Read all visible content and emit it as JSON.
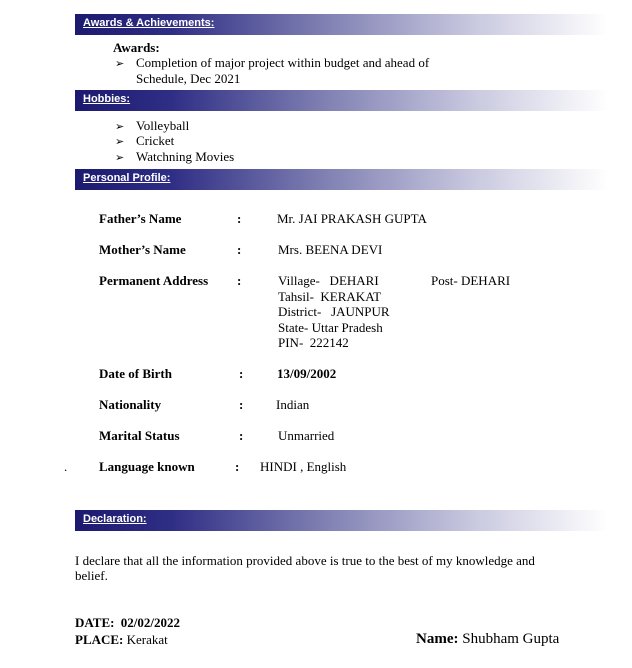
{
  "sections": {
    "awards": "Awards & Achievements:",
    "hobbies": "Hobbies:",
    "profile": "Personal Profile:",
    "declaration": "Declaration:"
  },
  "awards": {
    "heading": "Awards:",
    "item_line1": "Completion of major project within budget and ahead of",
    "item_line2": "Schedule, Dec 2021"
  },
  "hobbies": [
    "Volleyball",
    "Cricket",
    "Watchning Movies"
  ],
  "bullet": "➢",
  "colon": ":",
  "profile": {
    "father_label": "Father’s Name",
    "father_value": "Mr. JAI PRAKASH GUPTA",
    "mother_label": "Mother’s Name",
    "mother_value": "Mrs. BEENA DEVI",
    "address_label": "Permanent Address",
    "address_village": "Village-   DEHARI",
    "address_post": "Post- DEHARI",
    "address_tahsil": "Tahsil-  KERAKAT",
    "address_district": "District-   JAUNPUR",
    "address_state": "State- Uttar Pradesh",
    "address_pin": "PIN-  222142",
    "dob_label": "Date of Birth",
    "dob_value": "13/09/2002",
    "nationality_label": "Nationality",
    "nationality_value": "Indian",
    "marital_label": "Marital Status",
    "marital_value": "Unmarried",
    "language_label": "Language known",
    "language_value": "HINDI , English"
  },
  "stray_dot": ".",
  "declaration": {
    "line1": "I declare that all the information provided above is true to the best of my knowledge and",
    "line2": "belief."
  },
  "footer": {
    "date_label": "DATE:",
    "date_value": "02/02/2022",
    "place_label": "PLACE:",
    "place_value": "Kerakat",
    "name_label": "Name:",
    "name_value": "Shubham Gupta"
  }
}
